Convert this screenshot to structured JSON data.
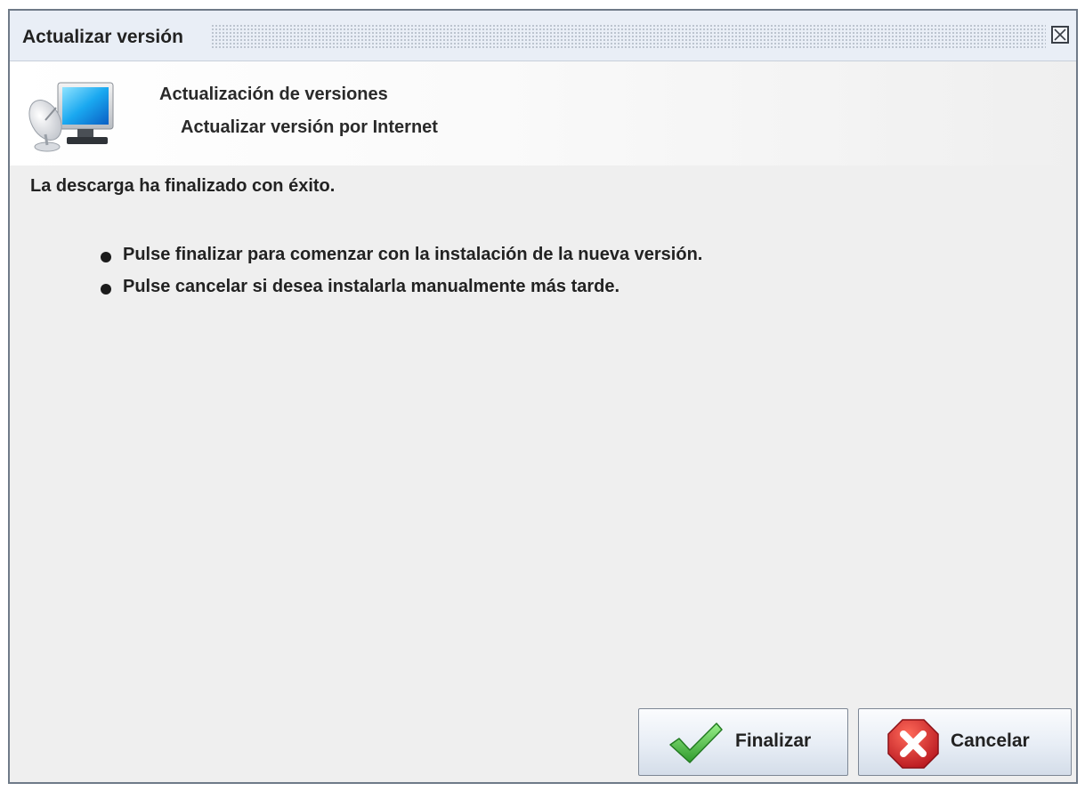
{
  "window": {
    "title": "Actualizar versión",
    "close_icon": "close-icon"
  },
  "header": {
    "icon": "satellite-computer-icon",
    "title": "Actualización de versiones",
    "subtitle": "Actualizar versión por Internet"
  },
  "content": {
    "message": "La descarga ha finalizado con éxito.",
    "bullets": [
      "Pulse finalizar para comenzar con la instalación de la nueva versión.",
      "Pulse cancelar si desea instalarla manualmente más tarde."
    ]
  },
  "buttons": {
    "finish": {
      "label": "Finalizar",
      "icon": "checkmark-icon",
      "icon_color": "#3bb83a"
    },
    "cancel": {
      "label": "Cancelar",
      "icon": "cancel-x-icon",
      "icon_color": "#d32b2b"
    }
  }
}
